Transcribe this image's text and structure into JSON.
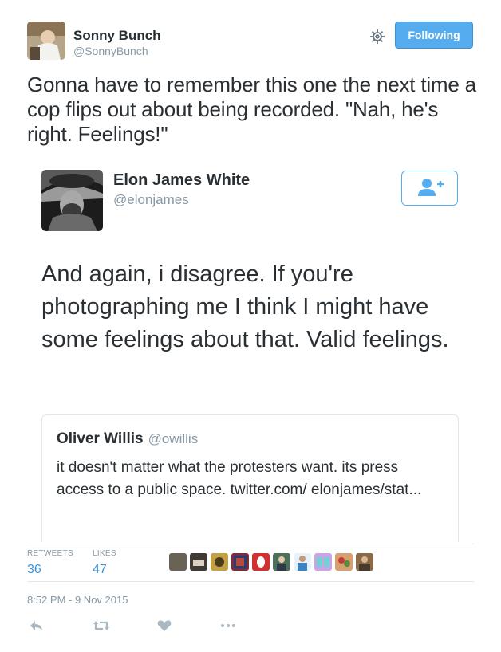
{
  "author": {
    "name": "Sonny Bunch",
    "handle": "@SonnyBunch"
  },
  "follow_button": {
    "label": "Following"
  },
  "tweet": {
    "text": "Gonna have to remember this one the next time a cop flips out about being recorded. \"Nah, he's right. Feelings!\""
  },
  "embedded_tweet": {
    "author_name": "Elon James White",
    "author_handle": "@elonjames",
    "text": "And again, i disagree. If you're photographing me I think I might have some feelings about that. Valid feelings.",
    "quoted_tweet": {
      "author_name": "Oliver Willis",
      "author_handle": "@owillis",
      "text": "it doesn't matter what the protesters want. its press access to a public space. twitter.com/ elonjames/stat..."
    }
  },
  "stats": {
    "retweets_label": "RETWEETS",
    "retweets_count": "36",
    "likes_label": "LIKES",
    "likes_count": "47"
  },
  "timestamp": "8:52 PM - 9 Nov 2015",
  "colors": {
    "accent": "#55acee",
    "link": "#3b94d9",
    "muted": "#8899a6",
    "border": "#e1e8ed"
  },
  "icons": [
    "gear-icon",
    "follow-user-icon",
    "reply-icon",
    "retweet-icon",
    "like-icon",
    "more-icon"
  ]
}
